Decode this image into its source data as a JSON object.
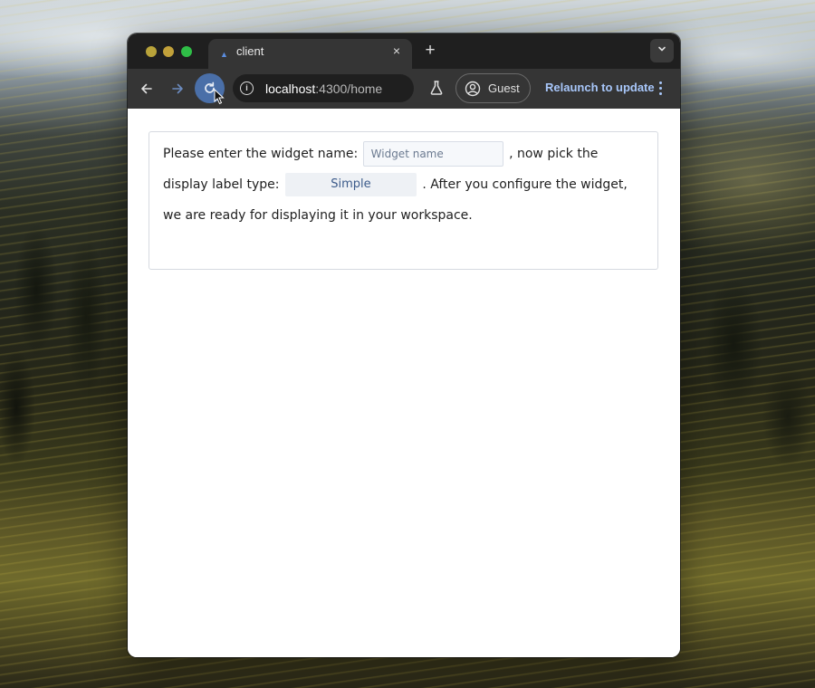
{
  "browser": {
    "tab": {
      "title": "client",
      "favicon": "angular-icon",
      "close": "×"
    },
    "new_tab": "+",
    "tab_menu": "chevron-down-icon",
    "address": {
      "host": "localhost",
      "path": ":4300/home"
    },
    "profile_label": "Guest",
    "relaunch_label": "Relaunch to update",
    "colors": {
      "frame": "#1f1f1f",
      "toolbar": "#353535",
      "accent": "#a8c7fa",
      "reload_hover": "#4a6fa8"
    }
  },
  "page": {
    "text_before_input": "Please enter the widget name: ",
    "name_placeholder": "Widget name",
    "name_value": "",
    "text_before_select": " , now pick the display label type: ",
    "label_type": "Simple",
    "text_after_select": " . After you configure the widget, we are ready for displaying it in your workspace."
  }
}
